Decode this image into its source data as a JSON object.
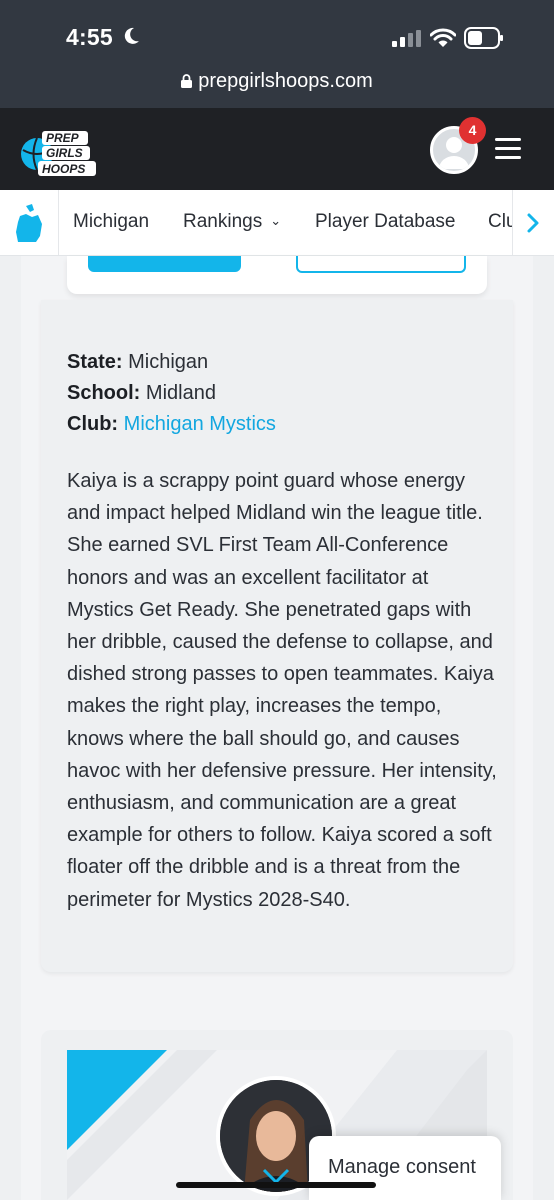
{
  "status_bar": {
    "time": "4:55",
    "url": "prepgirlshoops.com"
  },
  "header": {
    "logo_lines": [
      "PREP",
      "GIRLS",
      "HOOPS"
    ],
    "notification_count": "4"
  },
  "nav": {
    "items": [
      {
        "label": "Michigan"
      },
      {
        "label": "Rankings",
        "has_dropdown": true
      },
      {
        "label": "Player Database"
      },
      {
        "label": "Clu"
      }
    ]
  },
  "profile": {
    "state_label": "State:",
    "state_value": "Michigan",
    "school_label": "School:",
    "school_value": "Midland",
    "club_label": "Club:",
    "club_value": "Michigan Mystics",
    "bio": "Kaiya is a scrappy point guard whose energy and impact helped Midland win the league title. She earned SVL First Team All-Conference honors and was an excellent facilitator at Mystics Get Ready. She penetrated gaps with her dribble, caused the defense to collapse, and dished strong passes to open teammates. Kaiya makes the right play, increases the tempo, knows where the ball should go, and causes havoc with her defensive pressure. Her intensity, enthusiasm, and communication are a great example for others to follow. Kaiya scored a soft floater off the dribble and is a threat from the perimeter for Mystics 2028-S40."
  },
  "consent": {
    "label": "Manage consent"
  },
  "colors": {
    "accent": "#13b5ea",
    "header_bg": "#1f2125",
    "status_bg": "#323841",
    "badge": "#e03131"
  }
}
